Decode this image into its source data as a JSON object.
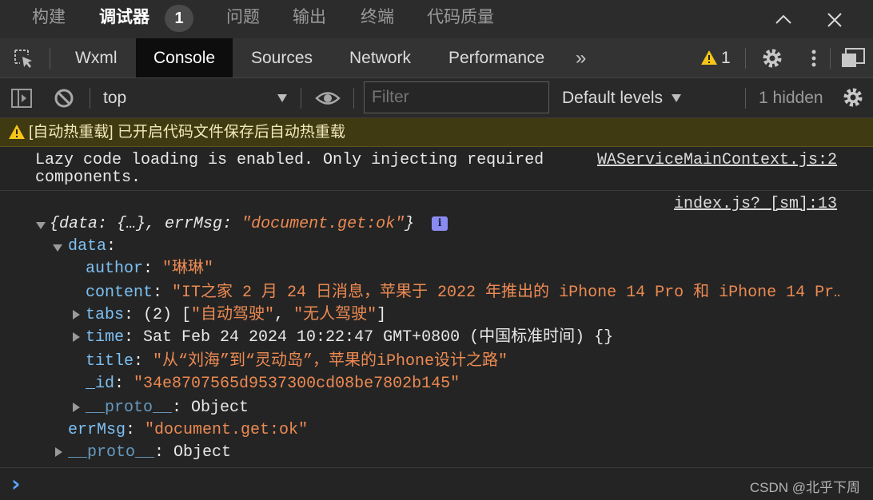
{
  "panel_tabs": [
    "构建",
    "调试器",
    "问题",
    "输出",
    "终端",
    "代码质量"
  ],
  "panel_active": "调试器",
  "debugger_badge": "1",
  "devtools_tabs": [
    "Wxml",
    "Console",
    "Sources",
    "Network",
    "Performance"
  ],
  "devtools_active": "Console",
  "more_tabs_glyph": "»",
  "warning_count": "1",
  "toolbar": {
    "context": "top",
    "filter_placeholder": "Filter",
    "levels": "Default levels",
    "hidden": "1 hidden"
  },
  "console": {
    "warning_message": "[自动热重载] 已开启代码文件保存后自动热重载",
    "lazy_message_line1": "Lazy code loading is enabled. Only injecting required",
    "lazy_message_line2": "components.",
    "lazy_source": "WAServiceMainContext.js:2",
    "log_source": "index.js? [sm]:13",
    "summary": {
      "open": "{",
      "k1": "data",
      "v1": ": {…}, ",
      "k2": "errMsg",
      "sep": ": ",
      "v2": "\"document.get:ok\"",
      "close": "}",
      "info": "i"
    },
    "data_key": "data",
    "fields": {
      "author_key": "author",
      "author_val": "\"琳琳\"",
      "content_key": "content",
      "content_val": "\"IT之家 2 月 24 日消息，苹果于 2022 年推出的 iPhone 14 Pro 和 iPhone 14 Pr…",
      "tabs_key": "tabs",
      "tabs_count": ": (2) [",
      "tabs_item1": "\"自动驾驶\"",
      "tabs_comma": ", ",
      "tabs_item2": "\"无人驾驶\"",
      "tabs_close": "]",
      "time_key": "time",
      "time_val": ": Sat Feb 24 2024 10:22:47 GMT+0800 (中国标准时间) {}",
      "title_key": "title",
      "title_val": "\"从“刘海”到“灵动岛”，苹果的iPhone设计之路\"",
      "id_key": "_id",
      "id_val": "\"34e8707565d9537300cd08be7802b145\"",
      "proto_key": "__proto__",
      "proto_val": ": Object"
    },
    "errmsg_key": "errMsg",
    "errmsg_val": "\"document.get:ok\"",
    "outer_proto_key": "__proto__",
    "outer_proto_val": ": Object"
  },
  "prompt_glyph": "›",
  "watermark": "CSDN @北乎下周",
  "colors": {
    "key": "#7dc0f2",
    "string": "#ec8a52",
    "warning_bg": "#403a12",
    "warning_icon": "#f5c518"
  }
}
